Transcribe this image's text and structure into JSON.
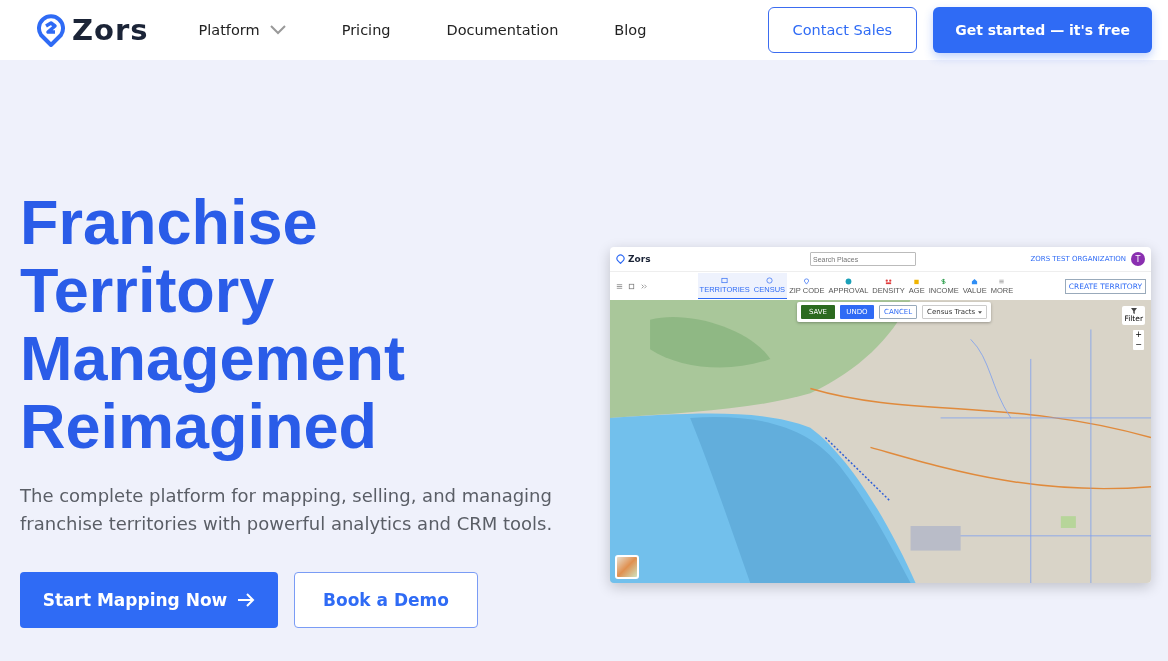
{
  "nav": {
    "brand": "Zors",
    "links": [
      {
        "label": "Platform",
        "dropdown": true
      },
      {
        "label": "Pricing",
        "dropdown": false
      },
      {
        "label": "Documentation",
        "dropdown": false
      },
      {
        "label": "Blog",
        "dropdown": false
      }
    ],
    "secondary_button": "Contact Sales",
    "primary_button": "Get started — it's free"
  },
  "hero": {
    "heading_lines": [
      "Franchise",
      "Territory",
      "Management",
      "Reimagined"
    ],
    "description": "The complete platform for mapping, selling, and managing franchise territories with powerful analytics and CRM tools.",
    "primary_button": "Start Mapping Now",
    "secondary_button": "Book a Demo"
  },
  "app": {
    "brand": "Zors",
    "search": {
      "placeholder": "Search Places"
    },
    "organization": "ZORS TEST ORGANIZATION",
    "avatar": "T",
    "toolbar": [
      {
        "label": "TERRITORIES",
        "selected": true
      },
      {
        "label": "CENSUS",
        "selected": true
      },
      {
        "label": "ZIP CODE",
        "selected": false
      },
      {
        "label": "APPROVAL",
        "selected": false
      },
      {
        "label": "DENSITY",
        "selected": false
      },
      {
        "label": "AGE",
        "selected": false
      },
      {
        "label": "INCOME",
        "selected": false
      },
      {
        "label": "VALUE",
        "selected": false
      },
      {
        "label": "MORE",
        "selected": false
      }
    ],
    "create_button": "CREATE TERRITORY",
    "save": "SAVE",
    "undo": "UNDO",
    "cancel": "CANCEL",
    "layer_select": "Census Tracts",
    "filter": "Filter",
    "zoom_in": "+",
    "zoom_out": "−"
  }
}
